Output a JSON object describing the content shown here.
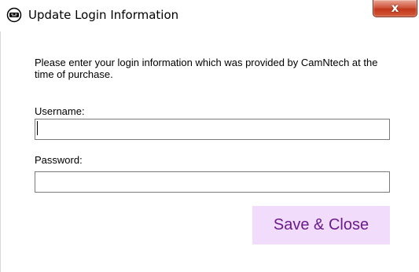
{
  "window": {
    "title": "Update Login Information",
    "app_icon": "gamepad-icon",
    "close_label": "x",
    "close_icon": "close-icon"
  },
  "form": {
    "instructions": "Please enter your login information which was provided by CamNtech at the time of purchase.",
    "username_label": "Username:",
    "username_value": "",
    "password_label": "Password:",
    "password_value": "",
    "save_label": "Save & Close"
  },
  "colors": {
    "close_button": "#c2381d",
    "save_button_bg": "#f2dcfb",
    "save_button_text": "#6a1b8c",
    "input_border": "#7a7a7a"
  }
}
